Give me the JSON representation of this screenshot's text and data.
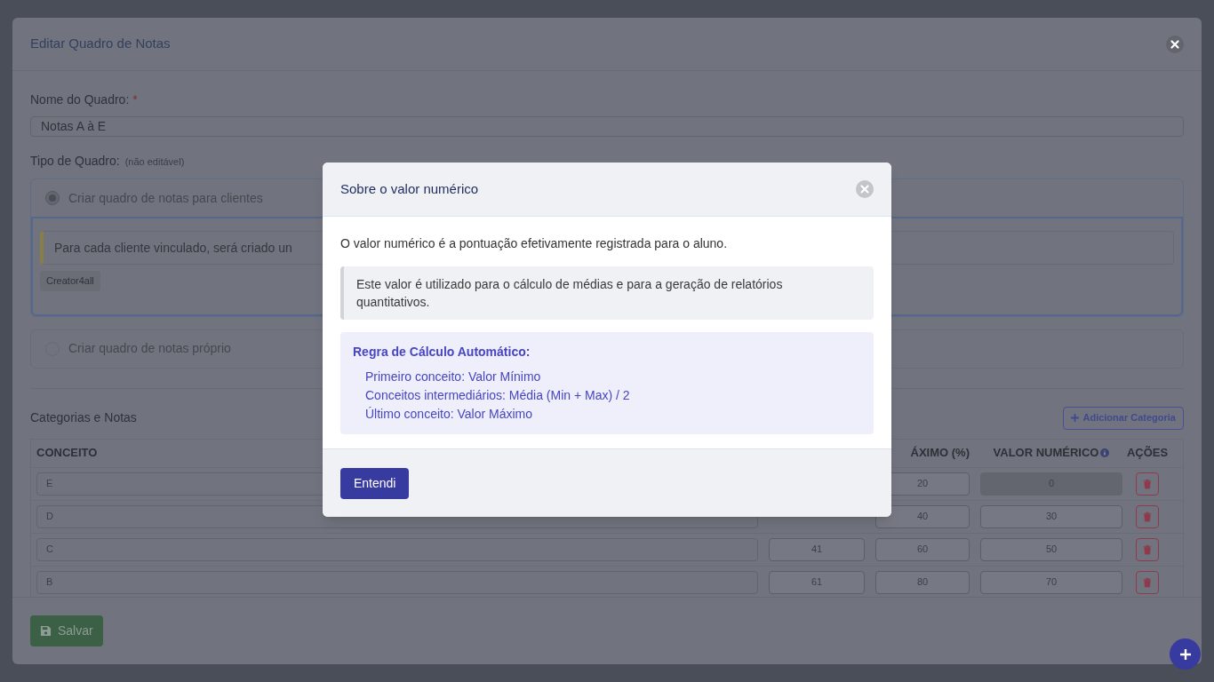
{
  "editor": {
    "title": "Editar Quadro de Notas",
    "name_field": {
      "label": "Nome do Quadro:",
      "required_mark": "*",
      "value": "Notas A à E"
    },
    "type_field": {
      "label": "Tipo de Quadro:",
      "hint": "(não editável)",
      "options": [
        {
          "label": "Criar quadro de notas para clientes",
          "selected": true,
          "notice": "Para cada cliente vinculado, será criado un",
          "tags": [
            "Creator4all"
          ]
        },
        {
          "label": "Criar quadro de notas próprio",
          "selected": false
        }
      ]
    },
    "categories": {
      "title": "Categorias e Notas",
      "add_button": "Adicionar Categoria",
      "columns": [
        {
          "label": "CONCEITO"
        },
        {
          "label": "ÁXIMO (%)"
        },
        {
          "label": "VALOR NUMÉRICO",
          "info": true
        },
        {
          "label": "AÇÕES"
        }
      ],
      "rows": [
        {
          "concept": "E",
          "max": "20",
          "value": "0",
          "value_disabled": true
        },
        {
          "concept": "D",
          "max": "40",
          "value": "30",
          "value_disabled": false
        },
        {
          "concept": "C",
          "min": "41",
          "max": "60",
          "value": "50",
          "value_disabled": false
        },
        {
          "concept": "B",
          "min": "61",
          "max": "80",
          "value": "70",
          "value_disabled": false
        }
      ]
    },
    "save_button": "Salvar"
  },
  "dialog": {
    "title": "Sobre o valor numérico",
    "intro": "O valor numérico é a pontuação efetivamente registrada para o aluno.",
    "note": "Este valor é utilizado para o cálculo de médias e para a geração de relatórios quantitativos.",
    "rule": {
      "title": "Regra de Cálculo Automático:",
      "lines": [
        "Primeiro conceito: Valor Mínimo",
        "Conceitos intermediários: Média (Min + Max) / 2",
        "Último conceito: Valor Máximo"
      ]
    },
    "button": "Entendi"
  }
}
